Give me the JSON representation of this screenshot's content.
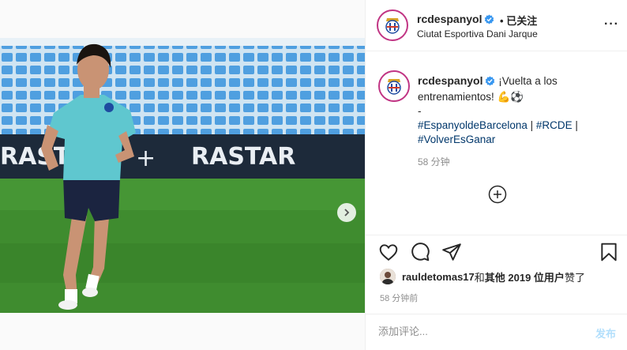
{
  "post": {
    "username": "rcdespanyol",
    "follow_separator": "•",
    "follow_label": "已关注",
    "location": "Ciutat Esportiva Dani Jarque",
    "more_label": "···"
  },
  "caption": {
    "username": "rcdespanyol",
    "text": "¡Vuelta a los entrenamientos! ",
    "emoji": "💪⚽",
    "dash": "-",
    "hashtags": [
      "#EspanyoldeBarcelona",
      "#RCDE",
      "#VolverEsGanar"
    ],
    "separator": " | ",
    "time": "58 分钟"
  },
  "photo": {
    "banner_text": "RASTAR",
    "active_slide": 4,
    "slide_count": 9,
    "colors": {
      "grass": "#3f8c2f",
      "shirt": "#5fc7cf",
      "shorts": "#1b2440",
      "seats": "#4f9fe0",
      "banner": "#1d2a3a"
    }
  },
  "likes": {
    "user": "rauldetomas17",
    "connector": " 和 ",
    "others": "其他 2019 位用户",
    "suffix": " 赞了"
  },
  "time_ago": "58 分钟前",
  "comment": {
    "placeholder": "添加评论...",
    "post_label": "发布"
  },
  "icons": [
    "verified-icon",
    "heart-icon",
    "comment-icon",
    "share-icon",
    "bookmark-icon",
    "add-circle-icon",
    "chevron-right-icon"
  ]
}
